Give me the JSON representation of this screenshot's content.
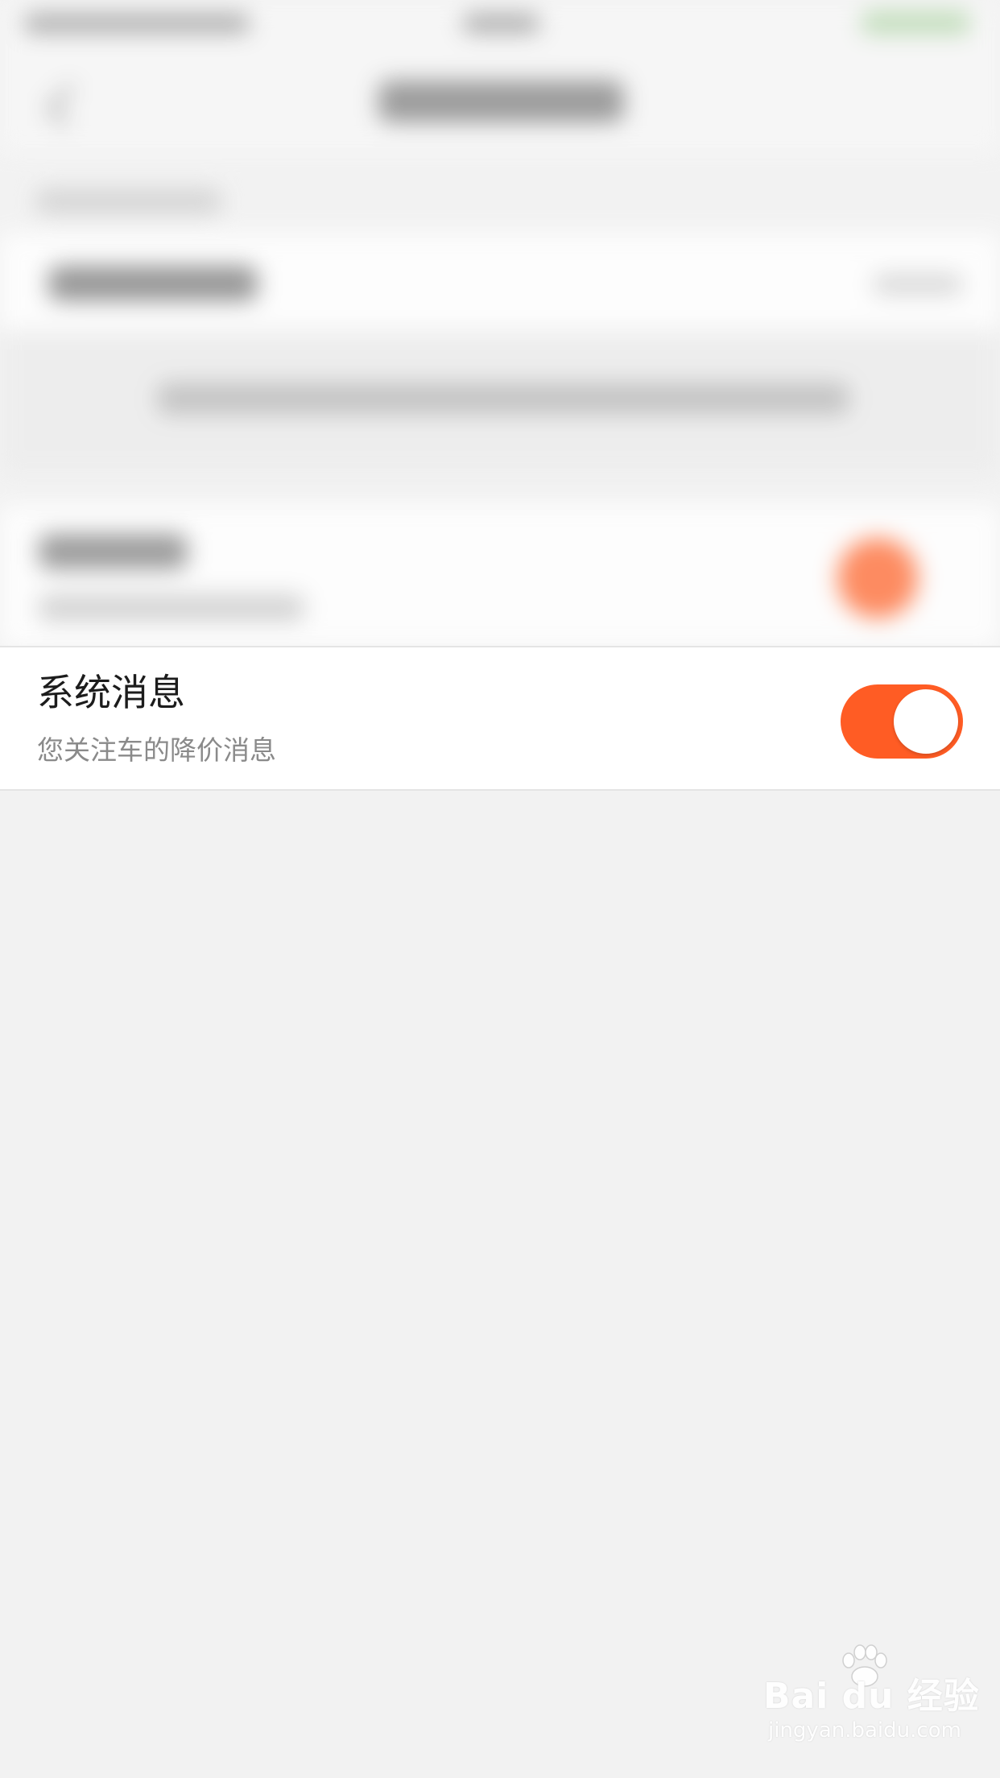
{
  "setting_row": {
    "title": "系统消息",
    "subtitle": "您关注车的降价消息",
    "toggle_on": true
  },
  "colors": {
    "accent": "#ff5c24",
    "page_background": "#f2f2f2",
    "row_background": "#ffffff",
    "title_text": "#1c1c1c",
    "subtitle_text": "#8a8a8a"
  },
  "watermark": {
    "logo_text": "Bai du 经验",
    "url_text": "jingyan.baidu.com"
  }
}
